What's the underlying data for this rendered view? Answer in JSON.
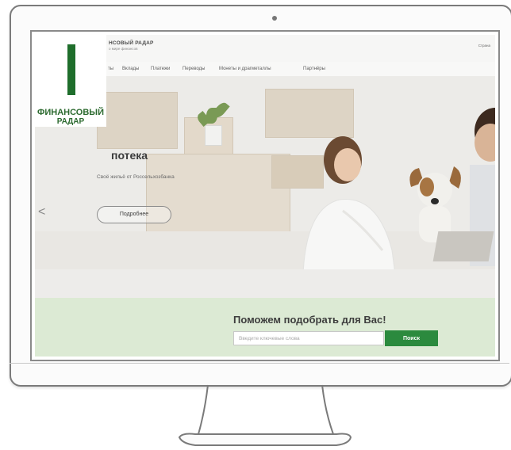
{
  "site": {
    "brand_name": "НСОВЫЙ РАДАР",
    "brand_tagline": "о мире финансов",
    "header_right": "Страна"
  },
  "logo": {
    "line1": "ФИНАНСОВЫЙ",
    "line2": "РАДАР"
  },
  "nav": {
    "items": [
      {
        "label": "ты"
      },
      {
        "label": "Вклады"
      },
      {
        "label": "Платежи"
      },
      {
        "label": "Переводы"
      },
      {
        "label": "Монеты и драгметаллы"
      },
      {
        "label": "Партнёры"
      }
    ]
  },
  "hero": {
    "title": "потека",
    "subtitle": "Своё жильё от Россельхозбанка",
    "more_button": "Подробнее",
    "arrow": "<"
  },
  "search": {
    "title": "Поможем подобрать для Вас!",
    "placeholder": "Введите ключевые слова",
    "button": "Поиск"
  },
  "colors": {
    "accent_green": "#2b8a3e",
    "band_green": "#dcead4",
    "logo_green": "#2c6a2f"
  }
}
